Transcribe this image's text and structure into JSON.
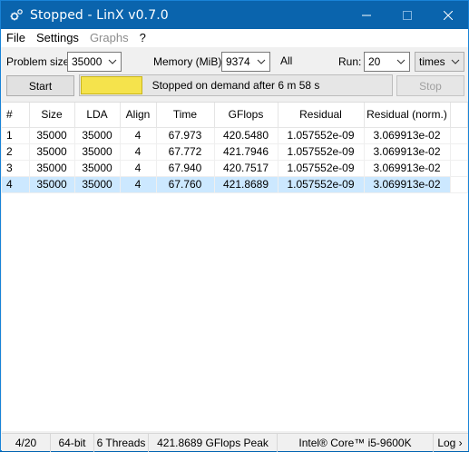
{
  "window": {
    "title": "Stopped - LinX v0.7.0"
  },
  "menu": {
    "items": [
      {
        "label": "File",
        "enabled": true
      },
      {
        "label": "Settings",
        "enabled": true
      },
      {
        "label": "Graphs",
        "enabled": false
      },
      {
        "label": "?",
        "enabled": true
      }
    ]
  },
  "controls": {
    "problem_size_label": "Problem size:",
    "problem_size_value": "35000",
    "memory_label": "Memory (MiB):",
    "memory_value": "9374",
    "all_label": "All",
    "run_label": "Run:",
    "run_value": "20",
    "run_unit": "times"
  },
  "actions": {
    "start_label": "Start",
    "stop_label": "Stop",
    "progress_text": "Stopped on demand after 6 m 58 s",
    "progress_fraction": 0.2,
    "progress_color": "#f5e34c"
  },
  "table": {
    "columns": [
      "#",
      "Size",
      "LDA",
      "Align",
      "Time",
      "GFlops",
      "Residual",
      "Residual (norm.)"
    ],
    "rows": [
      [
        "1",
        "35000",
        "35000",
        "4",
        "67.973",
        "420.5480",
        "1.057552e-09",
        "3.069913e-02"
      ],
      [
        "2",
        "35000",
        "35000",
        "4",
        "67.772",
        "421.7946",
        "1.057552e-09",
        "3.069913e-02"
      ],
      [
        "3",
        "35000",
        "35000",
        "4",
        "67.940",
        "420.7517",
        "1.057552e-09",
        "3.069913e-02"
      ],
      [
        "4",
        "35000",
        "35000",
        "4",
        "67.760",
        "421.8689",
        "1.057552e-09",
        "3.069913e-02"
      ]
    ],
    "selected_row": 3
  },
  "status": {
    "progress": "4/20",
    "bits": "64-bit",
    "threads": "6 Threads",
    "peak": "421.8689 GFlops Peak",
    "cpu": "Intel® Core™ i5-9600K",
    "log": "Log ›"
  },
  "colors": {
    "titlebar": "#0a64ad",
    "selection": "#cce8ff"
  }
}
